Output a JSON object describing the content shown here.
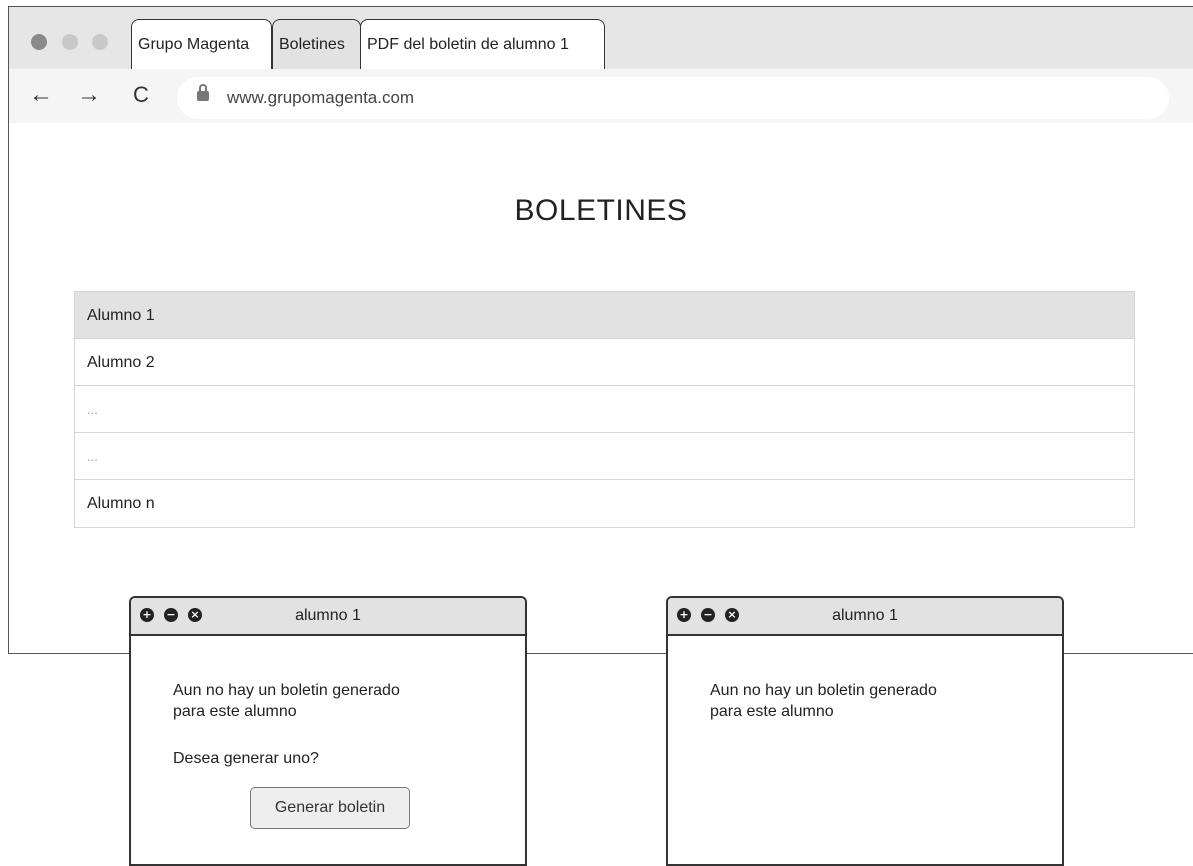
{
  "browser": {
    "tabs": [
      {
        "label": "Grupo Magenta"
      },
      {
        "label": "Boletines"
      },
      {
        "label": "PDF del boletin de alumno 1"
      }
    ],
    "url": "www.grupomagenta.com",
    "nav": {
      "back": "←",
      "forward": "→",
      "reload": "C"
    }
  },
  "page": {
    "title": "BOLETINES",
    "students": [
      {
        "label": "Alumno 1"
      },
      {
        "label": "Alumno 2"
      },
      {
        "label": "..."
      },
      {
        "label": "..."
      },
      {
        "label": "Alumno n"
      }
    ]
  },
  "dialogs": [
    {
      "title": "alumno 1",
      "controls": [
        "+",
        "−",
        "×"
      ],
      "message_line1": "Aun no hay un boletin generado",
      "message_line2": "para este alumno",
      "question": "Desea generar uno?",
      "button_label": "Generar boletin"
    },
    {
      "title": "alumno 1",
      "controls": [
        "+",
        "−",
        "×"
      ],
      "message_line1": "Aun no hay un boletin generado",
      "message_line2": "para este alumno"
    }
  ]
}
